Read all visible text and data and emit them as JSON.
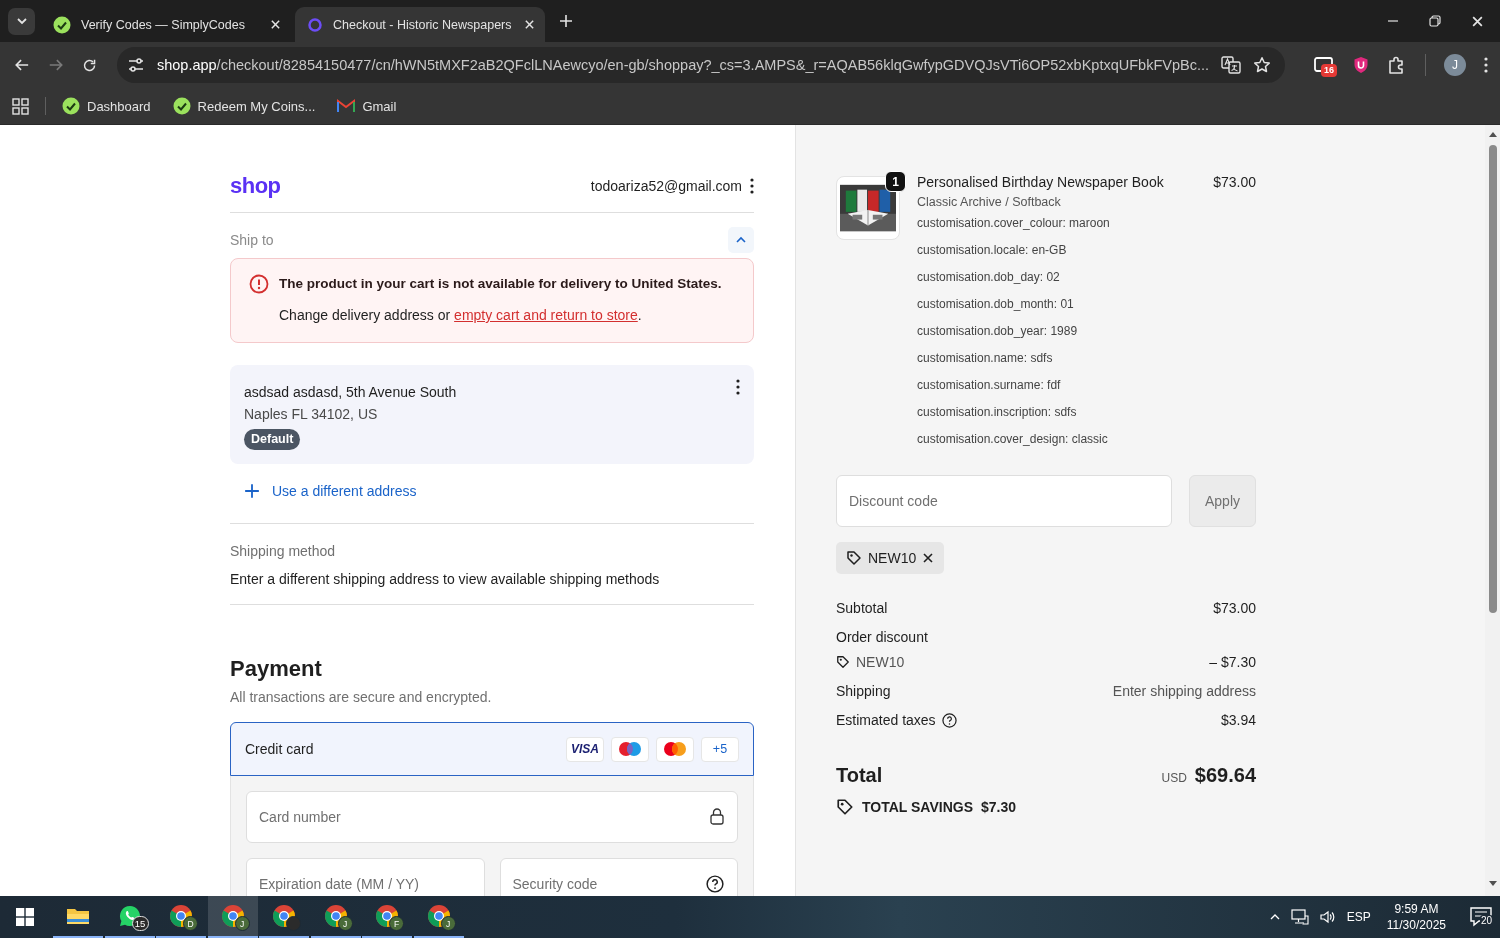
{
  "browser": {
    "tabs": [
      {
        "title": "Verify Codes — SimplyCodes",
        "selected": false
      },
      {
        "title": "Checkout - Historic Newspapers",
        "selected": true
      }
    ],
    "nav": {
      "back_disabled": false,
      "forward_disabled": true
    },
    "url": "shop.app/checkout/82854150477/cn/hWN5tMXF2aB2QFclLNAewcyo/en-gb/shoppay?_cs=3.AMPS&_r=AQAB56klqGwfypGDVQJsVTi6OP52xbKptxqUFbkFVpBc...",
    "extension_badge": "16",
    "profile": "J",
    "bookmarks": [
      {
        "label": "Dashboard"
      },
      {
        "label": "Redeem My Coins..."
      },
      {
        "label": "Gmail"
      }
    ]
  },
  "checkout": {
    "logo": "shop",
    "email": "todoariza52@gmail.com",
    "ship_to": {
      "label": "Ship to",
      "expanded": true,
      "alert": {
        "title": "The product in your cart is not available for delivery to United States.",
        "text_before": "Change delivery address or ",
        "link": "empty cart and return to store",
        "text_after": "."
      },
      "address": {
        "line1": "asdsad asdasd, 5th Avenue South",
        "line2": "Naples FL 34102, US",
        "badge": "Default"
      },
      "add_address": "Use a different address"
    },
    "shipping_method": {
      "label": "Shipping method",
      "message": "Enter a different shipping address to view available shipping methods"
    },
    "payment": {
      "title": "Payment",
      "subtitle": "All transactions are secure and encrypted.",
      "methods": [
        {
          "label": "Credit card",
          "selected": true,
          "brands": [
            {
              "kind": "visa",
              "label": "VISA"
            },
            {
              "kind": "maestro"
            },
            {
              "kind": "mastercard"
            },
            {
              "kind": "more",
              "label": "+5"
            }
          ]
        }
      ],
      "fields": [
        {
          "placeholder": "Card number"
        },
        {
          "placeholder": "Expiration date (MM / YY)"
        },
        {
          "placeholder": "Security code"
        }
      ]
    }
  },
  "summary": {
    "items": [
      {
        "quantity": "1",
        "title": "Personalised Birthday Newspaper Book",
        "variant": "Classic Archive / Softback",
        "price": "$73.00",
        "properties": [
          "customisation.cover_colour: maroon",
          "customisation.locale: en-GB",
          "customisation.dob_day: 02",
          "customisation.dob_month: 01",
          "customisation.dob_year: 1989",
          "customisation.name: sdfs",
          "customisation.surname: fdf",
          "customisation.inscription: sdfs",
          "customisation.cover_design: classic"
        ]
      }
    ],
    "discount": {
      "placeholder": "Discount code",
      "button": "Apply",
      "applied": [
        {
          "code": "NEW10"
        }
      ]
    },
    "lines": [
      {
        "kind": "row",
        "label": "Subtotal",
        "value": "$73.00"
      },
      {
        "kind": "heading",
        "label": "Order discount"
      },
      {
        "kind": "code",
        "label": "NEW10",
        "value": "– $7.30"
      },
      {
        "kind": "row",
        "label": "Shipping",
        "value": "Enter shipping address",
        "muted": true
      },
      {
        "kind": "help",
        "label": "Estimated taxes",
        "value": "$3.94"
      }
    ],
    "total": {
      "label": "Total",
      "currency": "USD",
      "value": "$69.64"
    },
    "savings": {
      "label": "TOTAL SAVINGS",
      "value": "$7.30"
    }
  },
  "taskbar": {
    "apps": [
      {
        "kind": "explorer",
        "running": true,
        "selected": false
      },
      {
        "kind": "whatsapp",
        "badge": "15",
        "running": true,
        "selected": false
      },
      {
        "kind": "chrome",
        "profile": "D",
        "running": true,
        "selected": false
      },
      {
        "kind": "chrome",
        "profile": "J",
        "running": true,
        "selected": true
      },
      {
        "kind": "chrome",
        "running": true,
        "selected": false
      },
      {
        "kind": "chrome",
        "profile": "J",
        "running": true,
        "selected": false
      },
      {
        "kind": "chrome",
        "profile": "F",
        "running": true,
        "selected": false
      },
      {
        "kind": "chrome",
        "profile": "J",
        "running": true,
        "selected": false
      }
    ],
    "language": "ESP",
    "time": "9:59 AM",
    "date": "11/30/2025",
    "notifications": "20"
  }
}
